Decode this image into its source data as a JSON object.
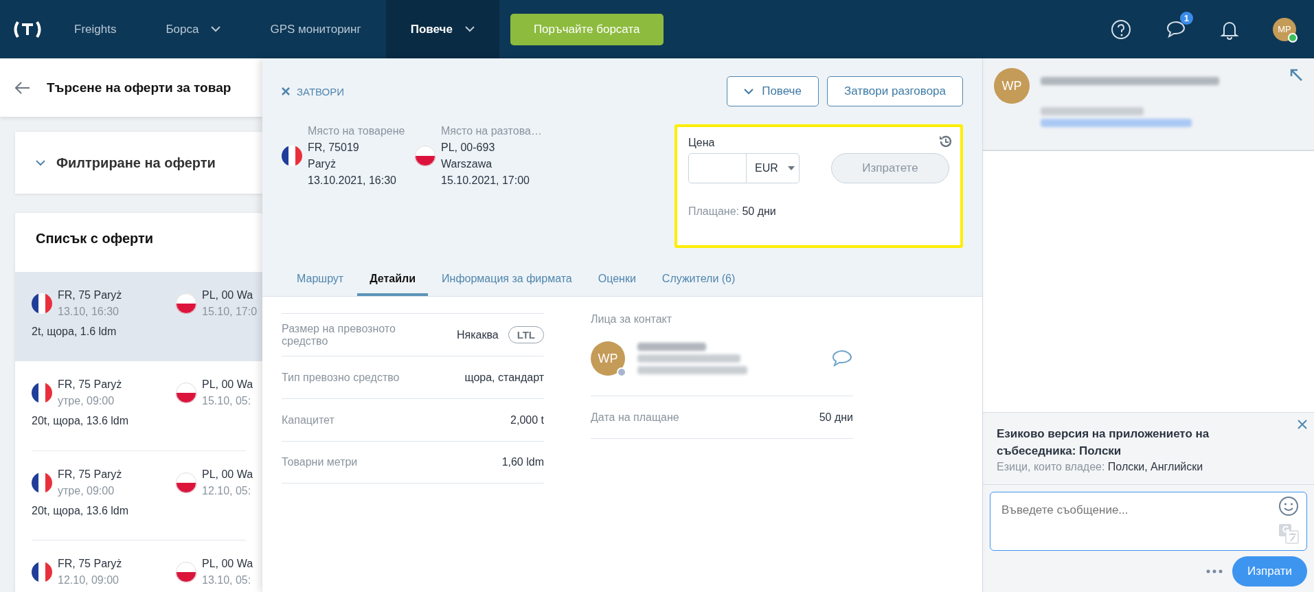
{
  "nav": {
    "items": [
      {
        "label": "Freights",
        "selected": false,
        "dropdown": false
      },
      {
        "label": "Борса",
        "selected": false,
        "dropdown": true
      },
      {
        "label": "GPS мониторинг",
        "selected": false,
        "dropdown": false
      },
      {
        "label": "Повече",
        "selected": true,
        "dropdown": true
      }
    ],
    "cta": "Поръчайте борсата",
    "chat_badge": "1",
    "avatar": "MP"
  },
  "left": {
    "title": "Търсене на оферти за товар",
    "filter": {
      "label": "Филтриране на оферти",
      "expanded": false
    },
    "list_title": "Списък с оферти",
    "offers": [
      {
        "from": "FR, 75 Paryż",
        "from_date": "13.10, 16:30",
        "to": "PL, 00 Wa",
        "to_date": "15.10, 17:0",
        "summary": "2t, щора, 1.6 ldm",
        "selected": true
      },
      {
        "from": "FR, 75 Paryż",
        "from_date": "утре, 09:00",
        "to": "PL, 00 Wa",
        "to_date": "15.10, 05:",
        "summary": "20t, щора, 13.6 ldm",
        "selected": false
      },
      {
        "from": "FR, 75 Paryż",
        "from_date": "утре, 09:00",
        "to": "PL, 00 Wa",
        "to_date": "12.10, 05:",
        "summary": "20t, щора, 13.6 ldm",
        "selected": false
      },
      {
        "from": "FR, 75 Paryż",
        "from_date": "12.10, 09:00",
        "to": "PL, 00 Wa",
        "to_date": "13.10, 05:",
        "selected": false
      }
    ]
  },
  "detail": {
    "close": "ЗАТВОРИ",
    "more": "Повече",
    "close_chat": "Затвори разговора",
    "places": [
      {
        "label": "Място на товарене",
        "lines": [
          "FR, 75019",
          "Paryż",
          "13.10.2021, 16:30"
        ]
      },
      {
        "label": "Място на разтова…",
        "lines": [
          "PL, 00-693",
          "Warszawa",
          "15.10.2021, 17:00"
        ]
      }
    ],
    "price": {
      "highlighted": true,
      "label": "Цена",
      "currency": "EUR",
      "send": "Изпратете",
      "send_disabled": true,
      "payment_label": "Плащане:",
      "payment_value": "50 дни"
    },
    "tabs": [
      {
        "label": "Маршрут",
        "selected": false
      },
      {
        "label": "Детайли",
        "selected": true
      },
      {
        "label": "Информация за фирмата",
        "selected": false
      },
      {
        "label": "Оценки",
        "selected": false
      },
      {
        "label": "Служители (6)",
        "selected": false
      }
    ],
    "rows": [
      {
        "label": "Размер на превозното средство",
        "value": "Някаква",
        "badge": "LTL"
      },
      {
        "label": "Тип превозно средство",
        "value": "щора, стандарт"
      },
      {
        "label": "Капацитет",
        "value": "2,000 t"
      },
      {
        "label": "Товарни метри",
        "value": "1,60 ldm"
      }
    ],
    "contacts": {
      "title": "Лица за контакт",
      "initials": "WP"
    },
    "payment_rows": [
      {
        "label": "Дата на плащане",
        "value": "50 дни"
      }
    ]
  },
  "chat": {
    "initials": "WP",
    "notice": {
      "title": "Езиково версия на приложението на събеседника: Полски",
      "languages_label": "Езици, които владее:",
      "languages": "Полски, Английски"
    },
    "placeholder": "Въведете съобщение...",
    "send": "Изпрати"
  }
}
